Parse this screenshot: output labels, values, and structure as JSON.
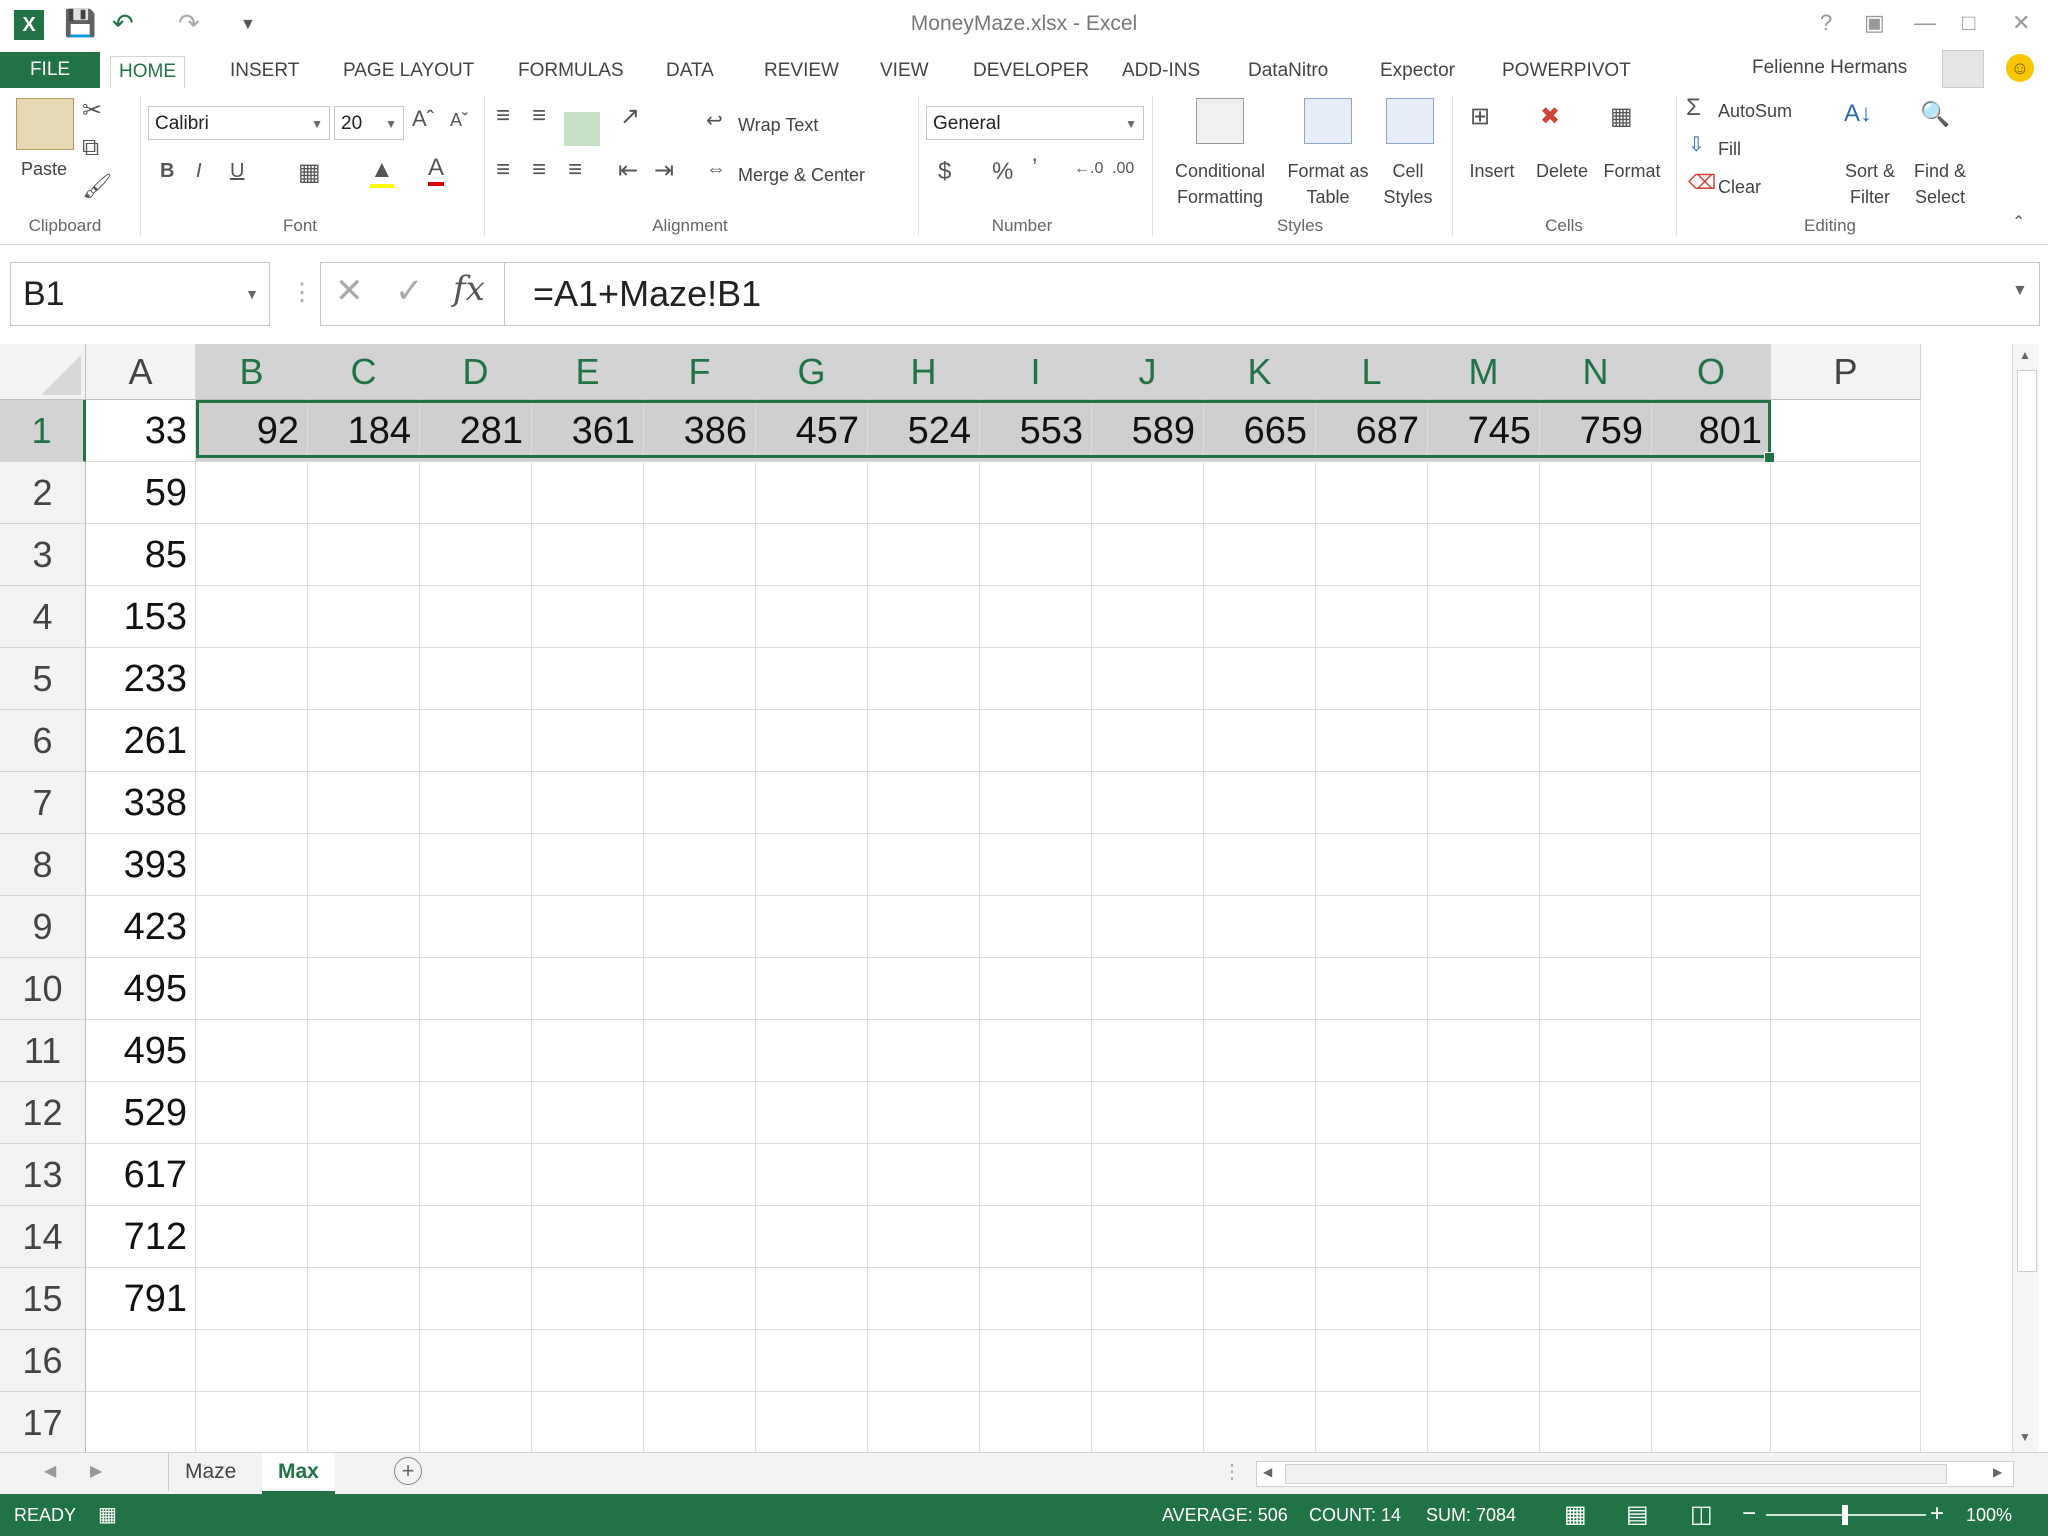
{
  "window": {
    "title": "MoneyMaze.xlsx - Excel"
  },
  "tabs": [
    "FILE",
    "HOME",
    "INSERT",
    "PAGE LAYOUT",
    "FORMULAS",
    "DATA",
    "REVIEW",
    "VIEW",
    "DEVELOPER",
    "ADD-INS",
    "DataNitro",
    "Expector",
    "POWERPIVOT"
  ],
  "user": {
    "name": "Felienne Hermans"
  },
  "ribbon": {
    "clipboard": {
      "paste": "Paste",
      "label": "Clipboard"
    },
    "font": {
      "name": "Calibri",
      "size": "20",
      "label": "Font"
    },
    "alignment": {
      "wrap": "Wrap Text",
      "merge": "Merge & Center",
      "label": "Alignment"
    },
    "number": {
      "format": "General",
      "label": "Number"
    },
    "styles": {
      "cond1": "Conditional",
      "cond2": "Formatting",
      "fmt1": "Format as",
      "fmt2": "Table",
      "cell1": "Cell",
      "cell2": "Styles",
      "label": "Styles"
    },
    "cells": {
      "insert": "Insert",
      "delete": "Delete",
      "format": "Format",
      "label": "Cells"
    },
    "editing": {
      "autosum": "AutoSum",
      "fill": "Fill",
      "clear": "Clear",
      "sort1": "Sort &",
      "sort2": "Filter",
      "find1": "Find &",
      "find2": "Select",
      "label": "Editing"
    }
  },
  "formula_bar": {
    "name_box": "B1",
    "formula": "=A1+Maze!B1"
  },
  "grid": {
    "columns": [
      "A",
      "B",
      "C",
      "D",
      "E",
      "F",
      "G",
      "H",
      "I",
      "J",
      "K",
      "L",
      "M",
      "N",
      "O",
      "P"
    ],
    "rows": [
      "1",
      "2",
      "3",
      "4",
      "5",
      "6",
      "7",
      "8",
      "9",
      "10",
      "11",
      "12",
      "13",
      "14",
      "15",
      "16",
      "17"
    ],
    "row1": [
      "33",
      "92",
      "184",
      "281",
      "361",
      "386",
      "457",
      "524",
      "553",
      "589",
      "665",
      "687",
      "745",
      "759",
      "801"
    ],
    "colA": [
      "33",
      "59",
      "85",
      "153",
      "233",
      "261",
      "338",
      "393",
      "423",
      "495",
      "495",
      "529",
      "617",
      "712",
      "791"
    ]
  },
  "sheets": [
    "Maze",
    "Max"
  ],
  "active_sheet": "Max",
  "status": {
    "ready": "READY",
    "average": "AVERAGE: 506",
    "count": "COUNT: 14",
    "sum": "SUM: 7084",
    "zoom": "100%"
  },
  "colors": {
    "accent": "#217346"
  }
}
